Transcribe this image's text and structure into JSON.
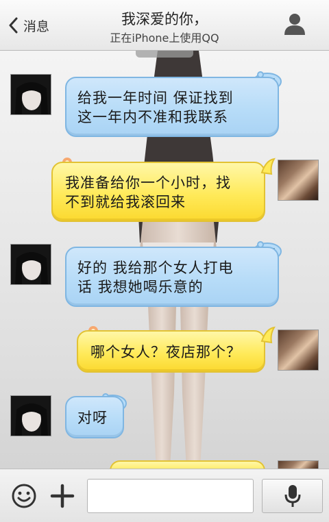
{
  "header": {
    "back_label": "消息",
    "title": "我深爱的你，",
    "subtitle": "正在iPhone上使用QQ"
  },
  "icons": {
    "back": "chevron-left-icon",
    "profile": "person-icon",
    "emoji": "smiley-icon",
    "plus": "plus-icon",
    "voice": "microphone-icon"
  },
  "colors": {
    "incoming_bubble": "#b7dcf8",
    "outgoing_bubble": "#ffea5a"
  },
  "messages": [
    {
      "sender": "contact",
      "line1": "给我一年时间  保证找到",
      "line2": "这一年内不准和我联系"
    },
    {
      "sender": "me",
      "line1": "我准备给你一个小时，找",
      "line2": "不到就给我滚回来"
    },
    {
      "sender": "contact",
      "line1": "好的  我给那个女人打电",
      "line2": "话  我想她喝乐意的"
    },
    {
      "sender": "me",
      "line1": "哪个女人？夜店那个？"
    },
    {
      "sender": "contact",
      "line1": "对呀"
    }
  ],
  "input": {
    "value": "",
    "placeholder": ""
  }
}
